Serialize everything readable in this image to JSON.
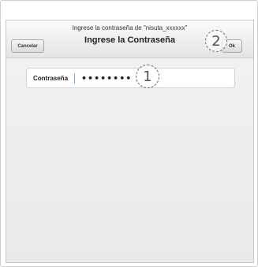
{
  "dialog": {
    "subtitle": "Ingrese la contraseña de \"nisuta_xxxxxx\"",
    "title": "Ingrese la Contraseña",
    "cancel_label": "Cancelar",
    "ok_label": "Ok"
  },
  "password_field": {
    "label": "Contraseña",
    "value": "••••••••"
  },
  "callouts": {
    "step_1": "1",
    "step_2": "2"
  }
}
